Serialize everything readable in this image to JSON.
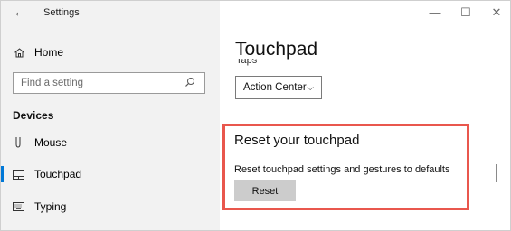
{
  "window": {
    "title": "Settings",
    "controls": {
      "minimize_glyph": "—",
      "maximize_glyph": "☐",
      "close_glyph": "✕"
    }
  },
  "sidebar": {
    "back_glyph": "←",
    "home": {
      "icon": "home-icon",
      "label": "Home"
    },
    "search": {
      "placeholder": "Find a setting",
      "icon": "search-icon"
    },
    "section_title": "Devices",
    "items": [
      {
        "icon": "mouse-icon",
        "label": "Mouse"
      },
      {
        "icon": "touchpad-icon",
        "label": "Touchpad",
        "selected": true
      },
      {
        "icon": "keyboard-icon",
        "label": "Typing"
      }
    ]
  },
  "main": {
    "page_title": "Touchpad",
    "clipped_label": "Taps",
    "dropdown": {
      "value": "Action Center",
      "chevron": "⌵"
    },
    "reset": {
      "title": "Reset your touchpad",
      "description": "Reset touchpad settings and gestures to defaults",
      "button_label": "Reset"
    }
  },
  "colors": {
    "accent": "#0078d7",
    "highlight_border": "#e9574d",
    "sidebar_bg": "#f2f2f2",
    "button_bg": "#cccccc"
  }
}
